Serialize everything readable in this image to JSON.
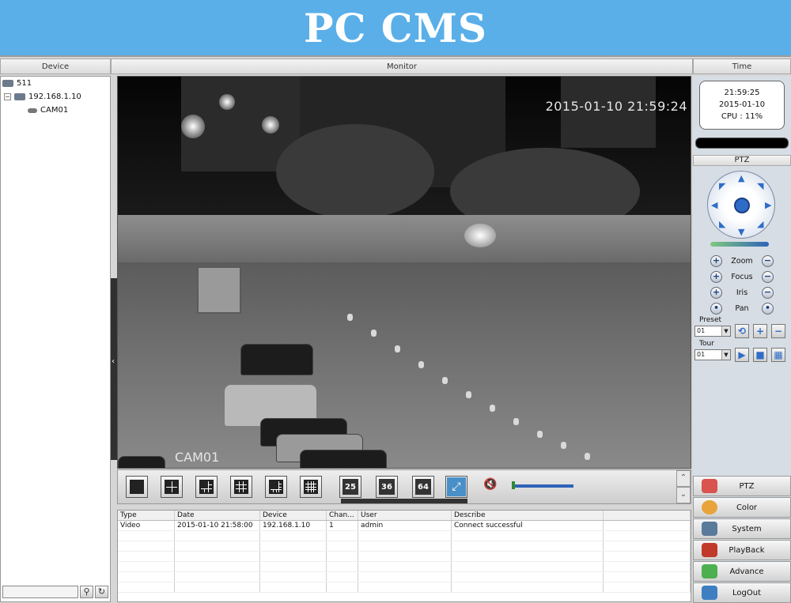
{
  "banner": {
    "title": "PC CMS"
  },
  "columns": {
    "device": "Device",
    "monitor": "Monitor",
    "time": "Time"
  },
  "device_tree": {
    "root": "511",
    "dvr": "192.168.1.10",
    "camera": "CAM01"
  },
  "video": {
    "osd_time": "2015-01-10 21:59:24",
    "osd_camera": "CAM01"
  },
  "layout_buttons": [
    "1",
    "4",
    "6",
    "9",
    "8",
    "16",
    "25",
    "36",
    "64",
    "full"
  ],
  "log": {
    "headers": [
      "Type",
      "Date",
      "Device",
      "Chan...",
      "User",
      "Describe"
    ],
    "rows": [
      [
        "Video",
        "2015-01-10 21:58:00",
        "192.168.1.10",
        "1",
        "admin",
        "Connect successful"
      ]
    ]
  },
  "time_panel": {
    "time": "21:59:25",
    "date": "2015-01-10",
    "cpu": "CPU : 11%"
  },
  "ptz": {
    "header": "PTZ",
    "zoom": "Zoom",
    "focus": "Focus",
    "iris": "Iris",
    "pan": "Pan",
    "preset_label": "Preset",
    "preset_value": "01",
    "tour_label": "Tour",
    "tour_value": "01"
  },
  "menu": [
    {
      "label": "PTZ",
      "icon": "ptz-icon",
      "color": "#d9534f"
    },
    {
      "label": "Color",
      "icon": "color-icon",
      "color": "#e8a33a"
    },
    {
      "label": "System",
      "icon": "system-icon",
      "color": "#5a7a9a"
    },
    {
      "label": "PlayBack",
      "icon": "playback-icon",
      "color": "#c0392b"
    },
    {
      "label": "Advance",
      "icon": "advance-icon",
      "color": "#4caf50"
    },
    {
      "label": "LogOut",
      "icon": "logout-icon",
      "color": "#3d7fc1"
    }
  ],
  "colors": {
    "banner": "#5aafe8",
    "accent": "#2f6cc8"
  }
}
